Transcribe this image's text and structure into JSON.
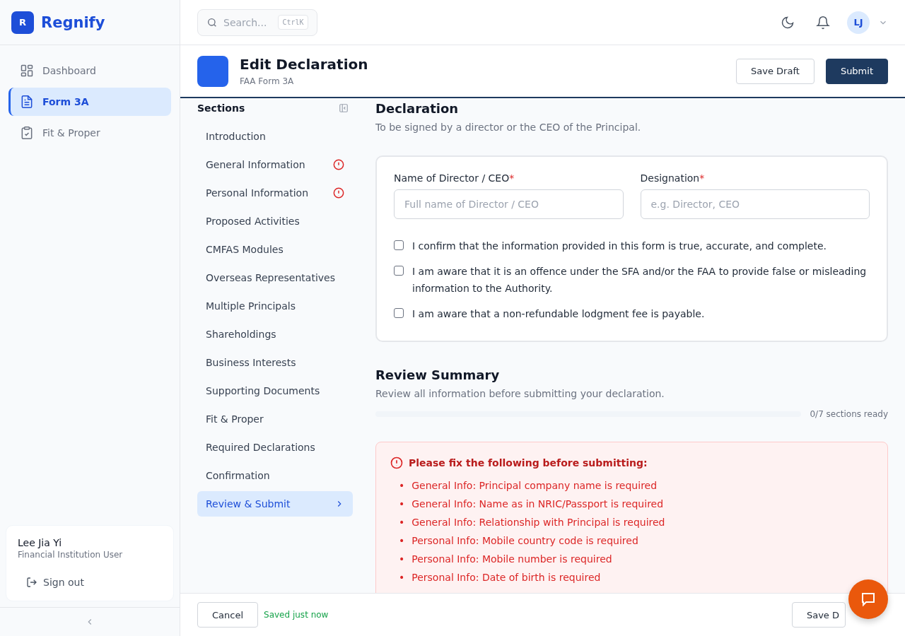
{
  "brand": {
    "logo_letter": "R",
    "name": "Regnify"
  },
  "nav": [
    {
      "label": "Dashboard",
      "selected": false
    },
    {
      "label": "Form 3A",
      "selected": true
    },
    {
      "label": "Fit & Proper",
      "selected": false
    }
  ],
  "user": {
    "name": "Lee Jia Yi",
    "role": "Financial Institution User",
    "sign_out": "Sign out",
    "initials": "LJ"
  },
  "search": {
    "placeholder": "Search...",
    "shortcut": "CtrlK"
  },
  "page": {
    "title": "Edit Declaration",
    "subtitle": "FAA Form 3A",
    "buttons": [
      {
        "label": "Save Draft",
        "kind": "secondary"
      },
      {
        "label": "Submit",
        "kind": "primary"
      }
    ]
  },
  "sections": {
    "title": "Sections",
    "items": [
      {
        "label": "Introduction",
        "error": false,
        "selected": false
      },
      {
        "label": "General Information",
        "error": true,
        "selected": false
      },
      {
        "label": "Personal Information",
        "error": true,
        "selected": false
      },
      {
        "label": "Proposed Activities",
        "error": false,
        "selected": false
      },
      {
        "label": "CMFAS Modules",
        "error": false,
        "selected": false
      },
      {
        "label": "Overseas Representatives",
        "error": false,
        "selected": false
      },
      {
        "label": "Multiple Principals",
        "error": false,
        "selected": false
      },
      {
        "label": "Shareholdings",
        "error": false,
        "selected": false
      },
      {
        "label": "Business Interests",
        "error": false,
        "selected": false
      },
      {
        "label": "Supporting Documents",
        "error": false,
        "selected": false
      },
      {
        "label": "Fit & Proper",
        "error": false,
        "selected": false
      },
      {
        "label": "Required Declarations",
        "error": false,
        "selected": false
      },
      {
        "label": "Confirmation",
        "error": false,
        "selected": false
      },
      {
        "label": "Review & Submit",
        "error": false,
        "selected": true
      }
    ]
  },
  "declaration": {
    "title": "Declaration",
    "description": "To be signed by a director or the CEO of the Principal.",
    "fields": [
      {
        "label": "Name of Director / CEO",
        "required_mark": "*",
        "placeholder": "Full name of Director / CEO"
      },
      {
        "label": "Designation",
        "required_mark": "*",
        "placeholder": "e.g. Director, CEO"
      }
    ],
    "checkboxes": [
      {
        "label": "I confirm that the information provided in this form is true, accurate, and complete.",
        "checked": false
      },
      {
        "label": "I am aware that it is an offence under the SFA and/or the FAA to provide false or misleading information to the Authority.",
        "checked": false
      },
      {
        "label": "I am aware that a non-refundable lodgment fee is payable.",
        "checked": false
      }
    ]
  },
  "review": {
    "title": "Review Summary",
    "description": "Review all information before submitting your declaration.",
    "progress": {
      "level": 0,
      "reading": "0/7 sections ready"
    },
    "errors": {
      "title": "Please fix the following before submitting:",
      "items": [
        {
          "marker": "•",
          "text": "General Info: Principal company name is required"
        },
        {
          "marker": "•",
          "text": "General Info: Name as in NRIC/Passport is required"
        },
        {
          "marker": "•",
          "text": "General Info: Relationship with Principal is required"
        },
        {
          "marker": "•",
          "text": "Personal Info: Mobile country code is required"
        },
        {
          "marker": "•",
          "text": "Personal Info: Mobile number is required"
        },
        {
          "marker": "•",
          "text": "Personal Info: Date of birth is required"
        }
      ]
    }
  },
  "footer": {
    "cancel": "Cancel",
    "status": "Saved just now",
    "save": "Save D"
  }
}
